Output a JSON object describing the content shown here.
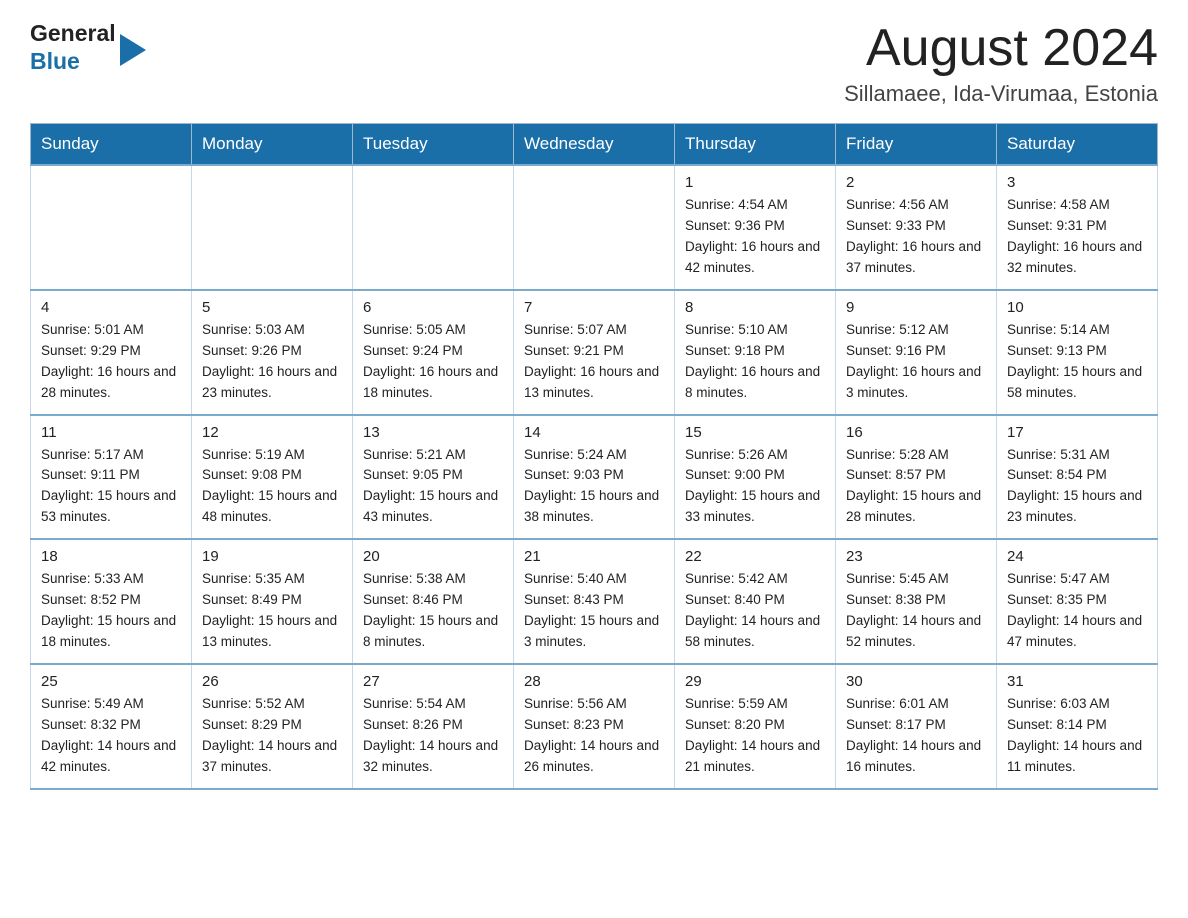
{
  "logo": {
    "general": "General",
    "blue": "Blue"
  },
  "title": "August 2024",
  "subtitle": "Sillamaee, Ida-Virumaa, Estonia",
  "days_of_week": [
    "Sunday",
    "Monday",
    "Tuesday",
    "Wednesday",
    "Thursday",
    "Friday",
    "Saturday"
  ],
  "weeks": [
    [
      {
        "day": "",
        "info": ""
      },
      {
        "day": "",
        "info": ""
      },
      {
        "day": "",
        "info": ""
      },
      {
        "day": "",
        "info": ""
      },
      {
        "day": "1",
        "info": "Sunrise: 4:54 AM\nSunset: 9:36 PM\nDaylight: 16 hours and 42 minutes."
      },
      {
        "day": "2",
        "info": "Sunrise: 4:56 AM\nSunset: 9:33 PM\nDaylight: 16 hours and 37 minutes."
      },
      {
        "day": "3",
        "info": "Sunrise: 4:58 AM\nSunset: 9:31 PM\nDaylight: 16 hours and 32 minutes."
      }
    ],
    [
      {
        "day": "4",
        "info": "Sunrise: 5:01 AM\nSunset: 9:29 PM\nDaylight: 16 hours and 28 minutes."
      },
      {
        "day": "5",
        "info": "Sunrise: 5:03 AM\nSunset: 9:26 PM\nDaylight: 16 hours and 23 minutes."
      },
      {
        "day": "6",
        "info": "Sunrise: 5:05 AM\nSunset: 9:24 PM\nDaylight: 16 hours and 18 minutes."
      },
      {
        "day": "7",
        "info": "Sunrise: 5:07 AM\nSunset: 9:21 PM\nDaylight: 16 hours and 13 minutes."
      },
      {
        "day": "8",
        "info": "Sunrise: 5:10 AM\nSunset: 9:18 PM\nDaylight: 16 hours and 8 minutes."
      },
      {
        "day": "9",
        "info": "Sunrise: 5:12 AM\nSunset: 9:16 PM\nDaylight: 16 hours and 3 minutes."
      },
      {
        "day": "10",
        "info": "Sunrise: 5:14 AM\nSunset: 9:13 PM\nDaylight: 15 hours and 58 minutes."
      }
    ],
    [
      {
        "day": "11",
        "info": "Sunrise: 5:17 AM\nSunset: 9:11 PM\nDaylight: 15 hours and 53 minutes."
      },
      {
        "day": "12",
        "info": "Sunrise: 5:19 AM\nSunset: 9:08 PM\nDaylight: 15 hours and 48 minutes."
      },
      {
        "day": "13",
        "info": "Sunrise: 5:21 AM\nSunset: 9:05 PM\nDaylight: 15 hours and 43 minutes."
      },
      {
        "day": "14",
        "info": "Sunrise: 5:24 AM\nSunset: 9:03 PM\nDaylight: 15 hours and 38 minutes."
      },
      {
        "day": "15",
        "info": "Sunrise: 5:26 AM\nSunset: 9:00 PM\nDaylight: 15 hours and 33 minutes."
      },
      {
        "day": "16",
        "info": "Sunrise: 5:28 AM\nSunset: 8:57 PM\nDaylight: 15 hours and 28 minutes."
      },
      {
        "day": "17",
        "info": "Sunrise: 5:31 AM\nSunset: 8:54 PM\nDaylight: 15 hours and 23 minutes."
      }
    ],
    [
      {
        "day": "18",
        "info": "Sunrise: 5:33 AM\nSunset: 8:52 PM\nDaylight: 15 hours and 18 minutes."
      },
      {
        "day": "19",
        "info": "Sunrise: 5:35 AM\nSunset: 8:49 PM\nDaylight: 15 hours and 13 minutes."
      },
      {
        "day": "20",
        "info": "Sunrise: 5:38 AM\nSunset: 8:46 PM\nDaylight: 15 hours and 8 minutes."
      },
      {
        "day": "21",
        "info": "Sunrise: 5:40 AM\nSunset: 8:43 PM\nDaylight: 15 hours and 3 minutes."
      },
      {
        "day": "22",
        "info": "Sunrise: 5:42 AM\nSunset: 8:40 PM\nDaylight: 14 hours and 58 minutes."
      },
      {
        "day": "23",
        "info": "Sunrise: 5:45 AM\nSunset: 8:38 PM\nDaylight: 14 hours and 52 minutes."
      },
      {
        "day": "24",
        "info": "Sunrise: 5:47 AM\nSunset: 8:35 PM\nDaylight: 14 hours and 47 minutes."
      }
    ],
    [
      {
        "day": "25",
        "info": "Sunrise: 5:49 AM\nSunset: 8:32 PM\nDaylight: 14 hours and 42 minutes."
      },
      {
        "day": "26",
        "info": "Sunrise: 5:52 AM\nSunset: 8:29 PM\nDaylight: 14 hours and 37 minutes."
      },
      {
        "day": "27",
        "info": "Sunrise: 5:54 AM\nSunset: 8:26 PM\nDaylight: 14 hours and 32 minutes."
      },
      {
        "day": "28",
        "info": "Sunrise: 5:56 AM\nSunset: 8:23 PM\nDaylight: 14 hours and 26 minutes."
      },
      {
        "day": "29",
        "info": "Sunrise: 5:59 AM\nSunset: 8:20 PM\nDaylight: 14 hours and 21 minutes."
      },
      {
        "day": "30",
        "info": "Sunrise: 6:01 AM\nSunset: 8:17 PM\nDaylight: 14 hours and 16 minutes."
      },
      {
        "day": "31",
        "info": "Sunrise: 6:03 AM\nSunset: 8:14 PM\nDaylight: 14 hours and 11 minutes."
      }
    ]
  ]
}
